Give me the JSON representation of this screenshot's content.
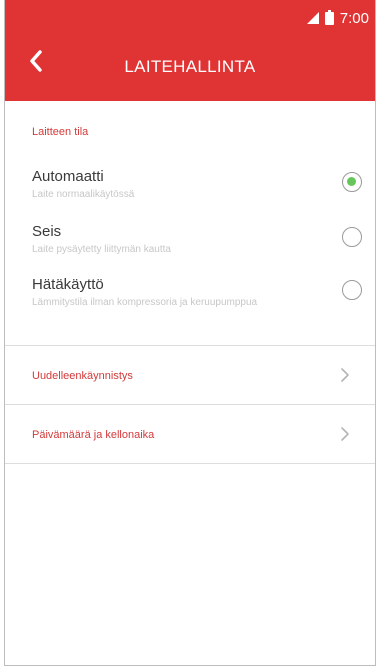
{
  "status_bar": {
    "time": "7:00",
    "icons": [
      "signal-icon",
      "battery-icon"
    ]
  },
  "header": {
    "title": "LAITEHALLINTA",
    "back_icon": "back-chevron-icon"
  },
  "section": {
    "title": "Laitteen tila",
    "options": [
      {
        "label": "Automaatti",
        "sublabel": "Laite normaalikäytössä",
        "selected": true
      },
      {
        "label": "Seis",
        "sublabel": "Laite pysäytetty liittymän kautta",
        "selected": false
      },
      {
        "label": "Hätäkäyttö",
        "sublabel": "Lämmitystila ilman kompressoria ja keruupumppua",
        "selected": false
      }
    ]
  },
  "menu": [
    {
      "label": "Uudelleenkäynnistys"
    },
    {
      "label": "Päivämäärä ja kellonaika"
    }
  ],
  "colors": {
    "accent": "#e03333",
    "label_red": "#d23a3a",
    "radio_selected": "#66c65a"
  }
}
